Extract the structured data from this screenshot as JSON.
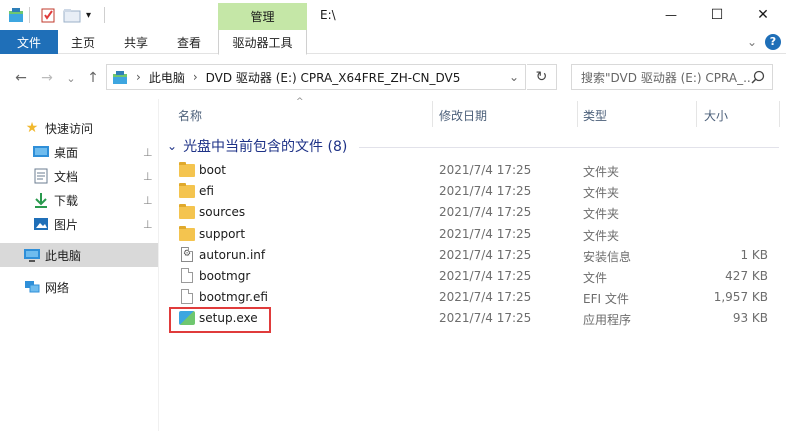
{
  "window": {
    "title": "E:\\",
    "manage_tab": "管理",
    "minimize_glyph": "—",
    "maximize_glyph": "☐",
    "close_glyph": "✕"
  },
  "ribbon": {
    "tabs": [
      "文件",
      "主页",
      "共享",
      "查看",
      "驱动器工具"
    ],
    "expand_glyph": "⌄",
    "help_glyph": "?"
  },
  "address": {
    "crumbs": [
      "此电脑",
      "DVD 驱动器 (E:) CPRA_X64FRE_ZH-CN_DV5"
    ],
    "search_placeholder": "搜索\"DVD 驱动器 (E:) CPRA_...",
    "back_glyph": "←",
    "forward_glyph": "→",
    "dropdown_glyph": "⌄",
    "up_glyph": "↑",
    "refresh_glyph": "↻",
    "sep_glyph": "›"
  },
  "navpane": {
    "quick_access": "快速访问",
    "quick_items": [
      {
        "label": "桌面",
        "icon": "desktop-icon"
      },
      {
        "label": "文档",
        "icon": "document-icon"
      },
      {
        "label": "下载",
        "icon": "download-icon"
      },
      {
        "label": "图片",
        "icon": "pictures-icon"
      }
    ],
    "this_pc": "此电脑",
    "network": "网络",
    "pin_glyph": "📌"
  },
  "columns": {
    "name": "名称",
    "date": "修改日期",
    "type": "类型",
    "size": "大小"
  },
  "group": {
    "label": "光盘中当前包含的文件 (8)",
    "chevron": "⌄"
  },
  "files": [
    {
      "name": "boot",
      "date": "2021/7/4 17:25",
      "type": "文件夹",
      "size": "",
      "icon": "folder-icon"
    },
    {
      "name": "efi",
      "date": "2021/7/4 17:25",
      "type": "文件夹",
      "size": "",
      "icon": "folder-icon"
    },
    {
      "name": "sources",
      "date": "2021/7/4 17:25",
      "type": "文件夹",
      "size": "",
      "icon": "folder-icon"
    },
    {
      "name": "support",
      "date": "2021/7/4 17:25",
      "type": "文件夹",
      "size": "",
      "icon": "folder-icon"
    },
    {
      "name": "autorun.inf",
      "date": "2021/7/4 17:25",
      "type": "安装信息",
      "size": "1 KB",
      "icon": "settings-file-icon"
    },
    {
      "name": "bootmgr",
      "date": "2021/7/4 17:25",
      "type": "文件",
      "size": "427 KB",
      "icon": "file-icon"
    },
    {
      "name": "bootmgr.efi",
      "date": "2021/7/4 17:25",
      "type": "EFI 文件",
      "size": "1,957 KB",
      "icon": "file-icon"
    },
    {
      "name": "setup.exe",
      "date": "2021/7/4 17:25",
      "type": "应用程序",
      "size": "93 KB",
      "icon": "setup-app-icon"
    }
  ],
  "colors": {
    "file_tab_bg": "#1f6fb8",
    "manage_tab_bg": "#c5e7a7",
    "group_text": "#1e3287",
    "highlight_box": "#e03b3b"
  }
}
